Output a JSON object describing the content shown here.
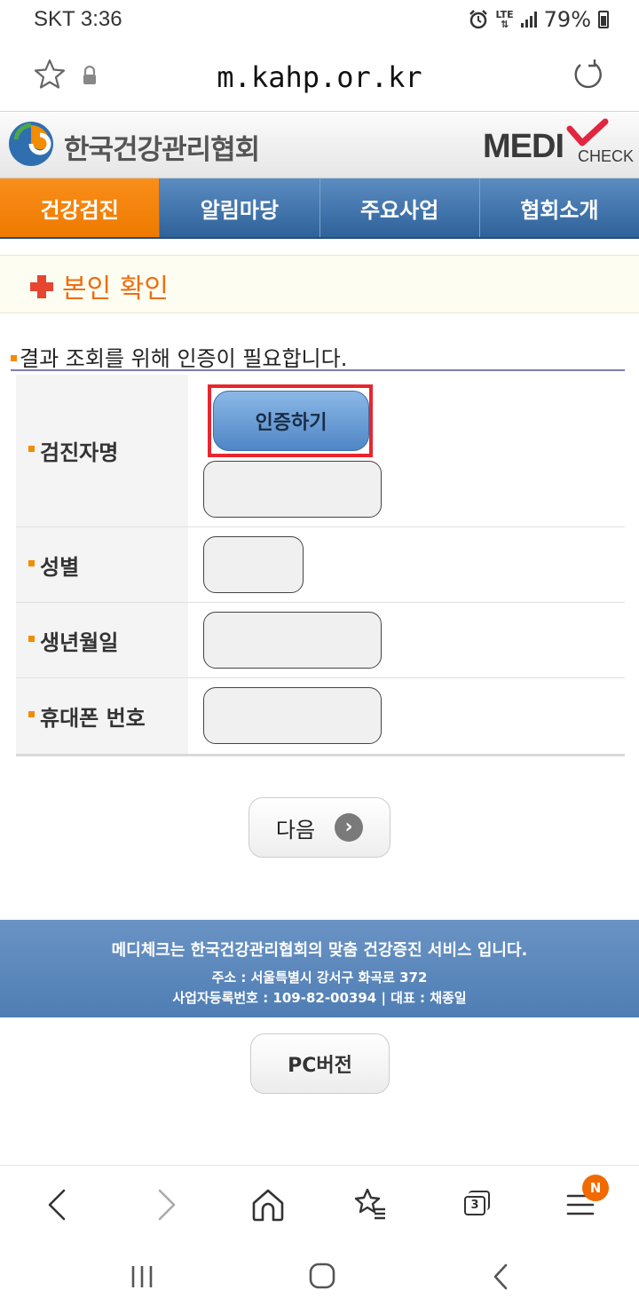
{
  "status_bar": {
    "carrier_time": "SKT 3:36",
    "network": "LTE",
    "battery": "79%"
  },
  "browser": {
    "url": "m.kahp.or.kr"
  },
  "site": {
    "name": "한국건강관리협회",
    "brand_main": "MEDI",
    "brand_sub": "CHECK"
  },
  "nav": {
    "items": [
      {
        "label": "건강검진",
        "active": true
      },
      {
        "label": "알림마당",
        "active": false
      },
      {
        "label": "주요사업",
        "active": false
      },
      {
        "label": "협회소개",
        "active": false
      }
    ]
  },
  "section": {
    "title": "본인 확인"
  },
  "notice": "결과 조회를 위해 인증이 필요합니다.",
  "form": {
    "name_label": "검진자명",
    "verify_button": "인증하기",
    "gender_label": "성별",
    "birth_label": "생년월일",
    "phone_label": "휴대폰 번호"
  },
  "next_button": "다음",
  "footer": {
    "line1": "메디체크는 한국건강관리협회의 맞춤 건강증진 서비스 입니다.",
    "line2": "주소 : 서울특별시 강서구 화곡로 372",
    "line3": "사업자등록번호 : 109-82-00394 | 대표 : 채종일"
  },
  "pc_button": "PC버전",
  "toolbar": {
    "tab_count": "3",
    "menu_badge": "N"
  },
  "colors": {
    "nav_active": "#ee7a00",
    "nav_bg": "#3a6ea5",
    "accent_orange": "#ee6d10",
    "highlight_red": "#e8262e"
  }
}
